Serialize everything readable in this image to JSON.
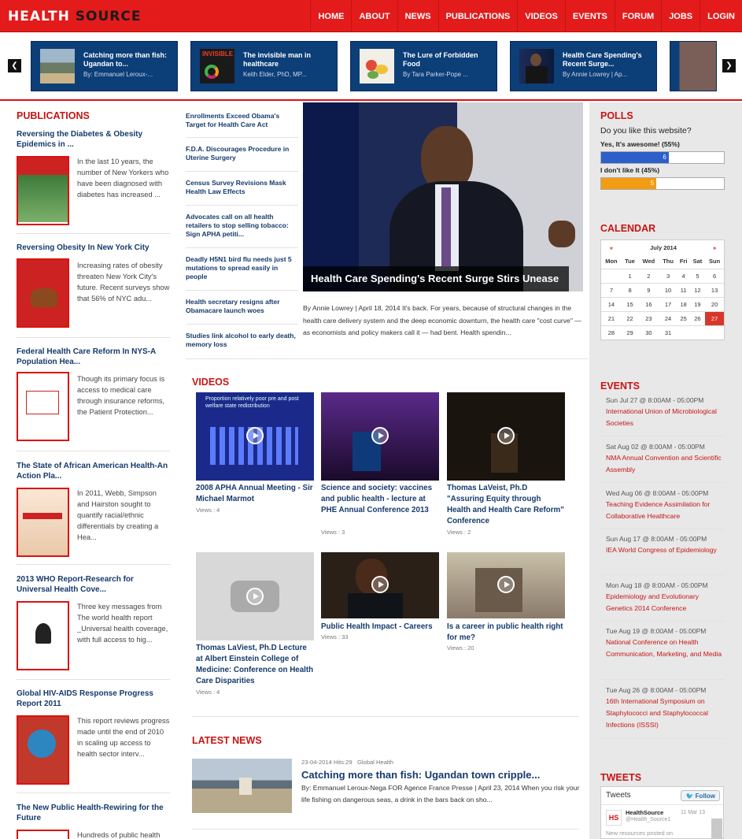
{
  "header": {
    "logo_health": "HEALTH",
    "logo_source": "SOURCE",
    "nav": [
      "HOME",
      "ABOUT",
      "NEWS",
      "PUBLICATIONS",
      "VIDEOS",
      "EVENTS",
      "FORUM",
      "JOBS",
      "LOGIN"
    ]
  },
  "carousel": {
    "prev": "❮",
    "next": "❯",
    "slides": [
      {
        "title": "Catching more than fish: Ugandan to...",
        "byline": "By: Emmanuel Leroux-..."
      },
      {
        "title": "The invisible man in healthcare",
        "byline": "Keith Elder, PhD, MP..."
      },
      {
        "title": "The Lure of Forbidden Food",
        "byline": "By Tara Parker-Pope ..."
      },
      {
        "title": "Health Care Spending's Recent Surge...",
        "byline": "By Annie Lowrey | Ap..."
      }
    ]
  },
  "publications": {
    "heading": "PUBLICATIONS",
    "items": [
      {
        "title": "Reversing the Diabetes & Obesity Epidemics in ...",
        "text": "In the last 10 years, the number of New Yorkers who have been diagnosed with diabetes has increased ..."
      },
      {
        "title": "Reversing Obesity In New York City",
        "text": "Increasing rates of obesity threaten New York City's future. Recent surveys show that 56% of NYC adu..."
      },
      {
        "title": "Federal Health Care Reform In NYS-A Population Hea...",
        "text": "Though its primary focus is access to medical care through insurance reforms, the Patient Protection..."
      },
      {
        "title": "The State of African American Health-An Action Pla...",
        "text": "In 2011, Webb, Simpson and Hairston sought to quantify racial/ethnic differentials by creating a Hea..."
      },
      {
        "title": "2013 WHO Report-Research for Universal Health Cove...",
        "text": "Three key messages from The world health report _Universal health coverage, with full access to hig..."
      },
      {
        "title": "Global HIV-AIDS Response Progress Report 2011",
        "text": "This report reviews progress made until the end of 2010 in scaling up access to health sector interv..."
      },
      {
        "title": "The New Public Health-Rewiring for the Future",
        "text": "Hundreds of public health"
      }
    ]
  },
  "midnews": [
    "Enrollments Exceed Obama's Target for Health Care Act",
    "F.D.A. Discourages Procedure in Uterine Surgery",
    "Census Survey Revisions Mask Health Law Effects",
    "Advocates call on all health retailers to stop selling tobacco: Sign APHA petiti...",
    "Deadly H5N1 bird flu needs just 5 mutations to spread easily in people",
    "Health secretary resigns after Obamacare launch woes",
    "Studies link alcohol to early death, memory loss"
  ],
  "feature": {
    "caption": "Health Care Spending's Recent Surge Stirs Unease",
    "text": "By Annie Lowrey | April 18, 2014 It's back. For years, because of structural changes in the health care delivery system and the deep economic downturn, the health care \"cost curve\" — as economists and policy makers call it — had bent. Health spendin..."
  },
  "videos": {
    "heading": "VIDEOS",
    "items": [
      {
        "title": "2008 APHA Annual Meeting - Sir Michael Marmot",
        "views": "Views : 4"
      },
      {
        "title": "Science and society: vaccines and public health - lecture at PHE Annual Conference 2013",
        "views": "Views : 3"
      },
      {
        "title": "Thomas LaVeist, Ph.D \"Assuring Equity through Health and Health Care Reform\" Conference",
        "views": "Views : 2"
      },
      {
        "title": "Thomas LaViest, Ph.D Lecture at Albert Einstein College of Medicine: Conference on Health Care Disparities",
        "views": "Views : 4"
      },
      {
        "title": "Public Health Impact - Careers",
        "views": "Views : 33"
      },
      {
        "title": "Is a career in public health right for me?",
        "views": "Views : 20"
      }
    ],
    "thumb1_text": "Proportion relatively poor pre and post welfare state redistribution"
  },
  "latest": {
    "heading": "LATEST NEWS",
    "meta": "23-04-2014 Hits:29",
    "category": "Global Health",
    "title": "Catching more than fish: Ugandan town cripple...",
    "text": "By: Emmanuel Leroux-Nega FOR Agence France Presse | April 23, 2014 When you risk your life fishing on dangerous seas, a drink in the bars back on sho..."
  },
  "polls": {
    "heading": "POLLS",
    "question": "Do you like this website?",
    "options": [
      {
        "label": "Yes, It's awesome! (55%)",
        "votes": "6",
        "fraction": 0.55,
        "color": "#2c5fc9"
      },
      {
        "label": "I don't like It (45%)",
        "votes": "5",
        "fraction": 0.45,
        "color": "#f39c12"
      }
    ]
  },
  "calendar": {
    "heading": "CALENDAR",
    "prev": "«",
    "next": "»",
    "month": "July 2014",
    "days": [
      "Mon",
      "Tue",
      "Wed",
      "Thu",
      "Fri",
      "Sat",
      "Sun"
    ],
    "weeks": [
      [
        "",
        "1",
        "2",
        "3",
        "4",
        "5",
        "6"
      ],
      [
        "7",
        "8",
        "9",
        "10",
        "11",
        "12",
        "13"
      ],
      [
        "14",
        "15",
        "16",
        "17",
        "18",
        "19",
        "20"
      ],
      [
        "21",
        "22",
        "23",
        "24",
        "25",
        "26",
        "27"
      ],
      [
        "28",
        "29",
        "30",
        "31",
        "",
        "",
        ""
      ]
    ],
    "today": "27"
  },
  "events": {
    "heading": "EVENTS",
    "items": [
      {
        "date": "Sun Jul 27 @ 8:00AM - 05:00PM",
        "title": "International Union of Microbiological Societies"
      },
      {
        "date": "Sat Aug 02 @ 8:00AM - 05:00PM",
        "title": "NMA Annual Convention and Scientific Assembly"
      },
      {
        "date": "Wed Aug 06 @ 8:00AM - 05:00PM",
        "title": "Teaching Evidence Assimilation for Collaborative Healthcare"
      },
      {
        "date": "Sun Aug 17 @ 8:00AM - 05:00PM",
        "title": "IEA World Congress of Epidemiology"
      },
      {
        "date": "Mon Aug 18 @ 8:00AM - 05:00PM",
        "title": "Epidemiology and Evolutionary Genetics 2014 Conference"
      },
      {
        "date": "Tue Aug 19 @ 8:00AM - 05:00PM",
        "title": "National Conference on Health Communication, Marketing, and Media"
      },
      {
        "date": "Tue Aug 26 @ 8:00AM - 05:00PM",
        "title": "16th International Symposium on Staphylococci and Staphylococcal Infections (ISSSI)"
      }
    ]
  },
  "tweets": {
    "heading": "TWEETS",
    "box_title": "Tweets",
    "follow": "Follow",
    "user": "HealthSource",
    "handle": "@Health_Source1",
    "date": "11 Mar 13",
    "text": "New resources posted on",
    "avatar": "HS"
  }
}
